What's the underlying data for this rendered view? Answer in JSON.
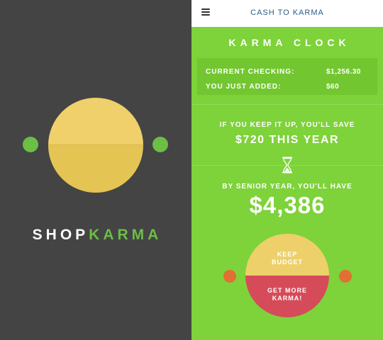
{
  "splash": {
    "brand_part1": "SHOP",
    "brand_part2": "KARMA"
  },
  "header": {
    "title": "CASH TO KARMA"
  },
  "karma_clock": {
    "title": "KARMA CLOCK",
    "current_checking_label": "CURRENT CHECKING:",
    "current_checking_value": "$1,256.30",
    "added_label": "YOU JUST ADDED:",
    "added_value": "$60",
    "keep_it_up_text": "IF YOU KEEP IT UP, YOU'LL SAVE",
    "yearly_savings": "$720 THIS YEAR",
    "senior_year_text": "BY SENIOR YEAR, YOU'LL HAVE",
    "senior_total": "$4,386"
  },
  "actions": {
    "keep_budget_line1": "KEEP",
    "keep_budget_line2": "BUDGET",
    "get_more_line1": "GET MORE",
    "get_more_line2": "KARMA!"
  },
  "colors": {
    "panel_dark": "#444444",
    "brand_green": "#6CBE45",
    "app_green": "#7ED23A",
    "disc_yellow": "#EFD06B",
    "button_red": "#D64B59",
    "dot_orange": "#E07033",
    "nav_text": "#2A5C8A"
  },
  "icons": {
    "menu": "hamburger-icon",
    "timer": "hourglass-icon"
  }
}
